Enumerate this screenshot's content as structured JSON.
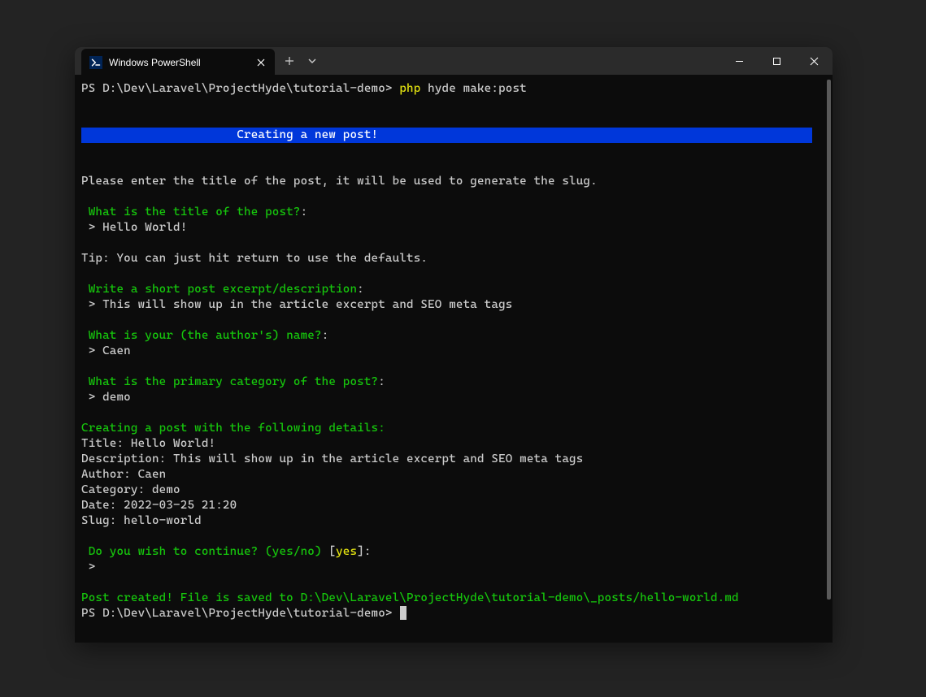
{
  "tab": {
    "title": "Windows PowerShell"
  },
  "terminal": {
    "prompt1_prefix": "PS D:\\Dev\\Laravel\\ProjectHyde\\tutorial-demo> ",
    "cmd_php": "php",
    "cmd_rest": " hyde make:post",
    "banner_pad": "                      ",
    "banner_text": "Creating a new post!",
    "banner_trail": "                                                                    ",
    "intro": "Please enter the title of the post, it will be used to generate the slug.",
    "q1": "What is the title of the post?",
    "a1": " > Hello World!",
    "tip": "Tip: You can just hit return to use the defaults.",
    "q2": "Write a short post excerpt/description",
    "a2": " > This will show up in the article excerpt and SEO meta tags",
    "q3": "What is your (the author's) name?",
    "a3": " > Caen",
    "q4": "What is the primary category of the post?",
    "a4": " > demo",
    "summary_header": "Creating a post with the following details:",
    "sum_title": "Title: Hello World!",
    "sum_desc": "Description: This will show up in the article excerpt and SEO meta tags",
    "sum_author": "Author: Caen",
    "sum_category": "Category: demo",
    "sum_date": "Date: 2022-03-25 21:20",
    "sum_slug": "Slug: hello-world",
    "confirm_q": "Do you wish to continue? (yes/no)",
    "confirm_bracket_open": " [",
    "confirm_default": "yes",
    "confirm_bracket_close": "]",
    "confirm_colon": ":",
    "confirm_answer": " >",
    "success": "Post created! File is saved to D:\\Dev\\Laravel\\ProjectHyde\\tutorial-demo\\_posts/hello-world.md",
    "prompt2": "PS D:\\Dev\\Laravel\\ProjectHyde\\tutorial-demo> ",
    "colon": ":",
    "space_indent": " "
  }
}
